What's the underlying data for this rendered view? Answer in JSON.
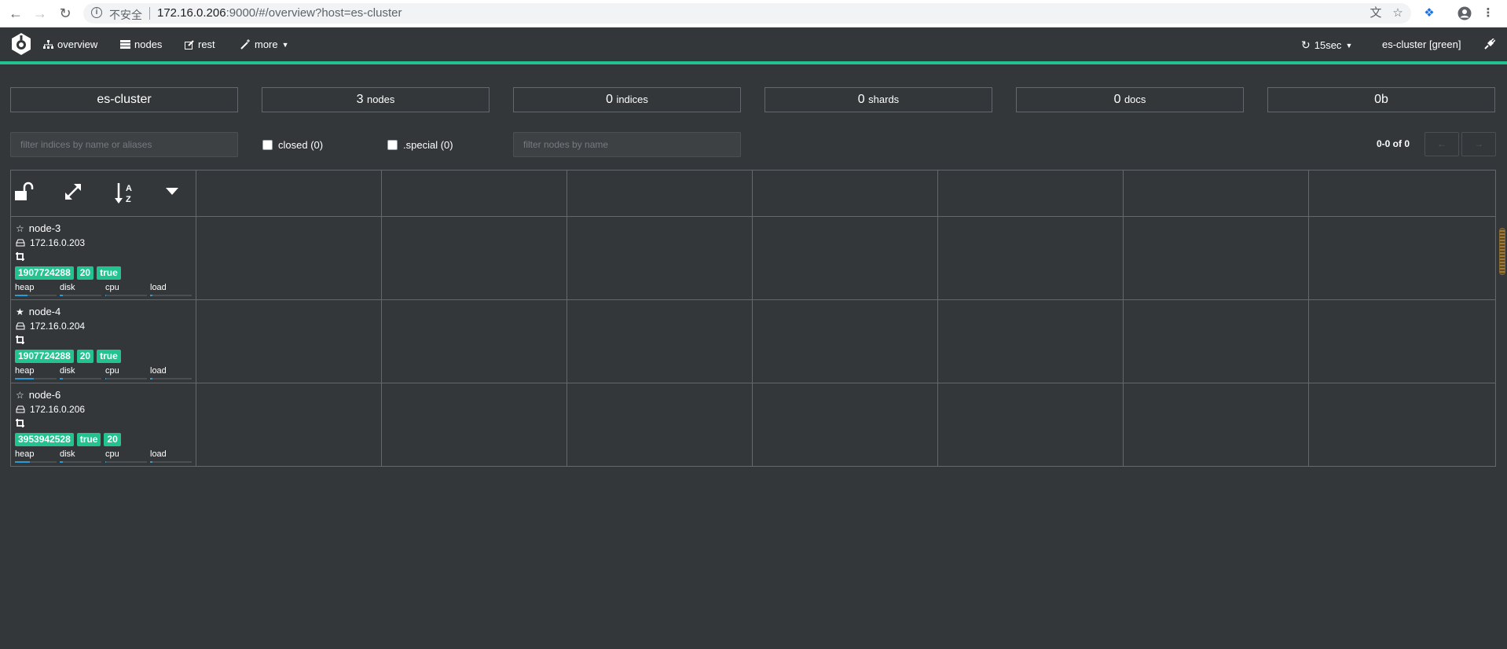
{
  "browser": {
    "insecure_label": "不安全",
    "url_host": "172.16.0.206",
    "url_rest": ":9000/#/overview?host=es-cluster"
  },
  "navbar": {
    "overview": "overview",
    "nodes": "nodes",
    "rest": "rest",
    "more": "more",
    "refresh": "15sec",
    "cluster_status": "es-cluster [green]"
  },
  "stats": {
    "cluster_name": "es-cluster",
    "nodes_count": "3",
    "nodes_label": "nodes",
    "indices_count": "0",
    "indices_label": "indices",
    "shards_count": "0",
    "shards_label": "shards",
    "docs_count": "0",
    "docs_label": "docs",
    "size": "0b"
  },
  "filters": {
    "indices_placeholder": "filter indices by name or aliases",
    "closed_label": "closed (0)",
    "special_label": ".special (0)",
    "nodes_placeholder": "filter nodes by name",
    "pager": "0-0 of 0",
    "prev": "←",
    "next": "→"
  },
  "nodes": [
    {
      "name": "node-3",
      "ip": "172.16.0.203",
      "master": false,
      "badges": [
        "1907724288",
        "20",
        "true"
      ],
      "heap": 0.3,
      "disk": 0.08,
      "cpu": 0.02,
      "load": 0.05
    },
    {
      "name": "node-4",
      "ip": "172.16.0.204",
      "master": true,
      "badges": [
        "1907724288",
        "20",
        "true"
      ],
      "heap": 0.45,
      "disk": 0.08,
      "cpu": 0.02,
      "load": 0.05
    },
    {
      "name": "node-6",
      "ip": "172.16.0.206",
      "master": false,
      "badges": [
        "3953942528",
        "true",
        "20"
      ],
      "heap": 0.35,
      "disk": 0.08,
      "cpu": 0.02,
      "load": 0.05
    }
  ],
  "metric_labels": {
    "heap": "heap",
    "disk": "disk",
    "cpu": "cpu",
    "load": "load"
  },
  "colors": {
    "accent": "#22c38e",
    "background": "#33373a",
    "bar": "#2a9bd4"
  }
}
